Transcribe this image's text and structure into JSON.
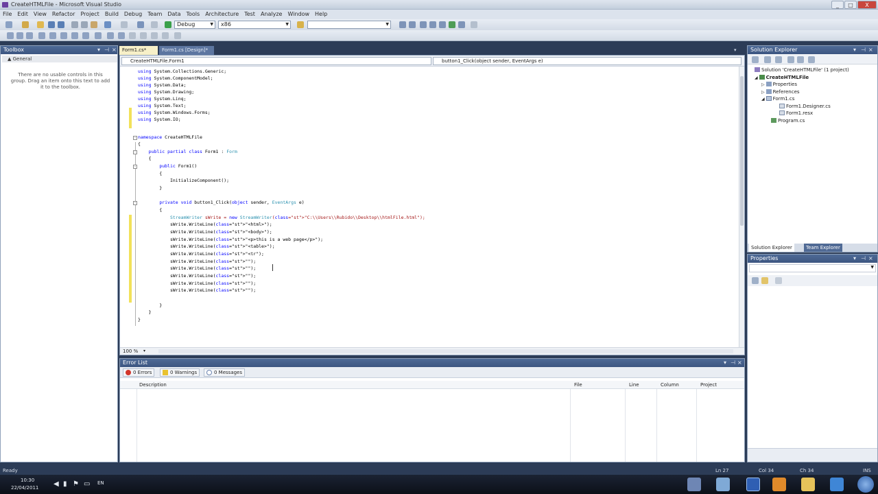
{
  "window": {
    "title": "CreateHTMLFile - Microsoft Visual Studio",
    "controls": [
      "_",
      "□",
      "X"
    ]
  },
  "menu": [
    "File",
    "Edit",
    "View",
    "Refactor",
    "Project",
    "Build",
    "Debug",
    "Team",
    "Data",
    "Tools",
    "Architecture",
    "Test",
    "Analyze",
    "Window",
    "Help"
  ],
  "toolbar": {
    "config": "Debug",
    "platform": "x86",
    "find": ""
  },
  "toolbox": {
    "title": "Toolbox",
    "group": "▲ General",
    "message": "There are no usable controls in this group. Drag an item onto this text to add it to the toolbox."
  },
  "tabs": [
    "Form1.cs*",
    "Form1.cs [Design]*"
  ],
  "nav": {
    "left": "CreateHTMLFile.Form1",
    "right": "button1_Click(object sender, EventArgs e)"
  },
  "code": [
    "using System.Collections.Generic;",
    "using System.ComponentModel;",
    "using System.Data;",
    "using System.Drawing;",
    "using System.Linq;",
    "using System.Text;",
    "using System.Windows.Forms;",
    "using System.IO;",
    "",
    "namespace CreateHTMLFile",
    "{",
    "    public partial class Form1 : Form",
    "    {",
    "        public Form1()",
    "        {",
    "            InitializeComponent();",
    "        }",
    "",
    "        private void button1_Click(object sender, EventArgs e)",
    "        {",
    "            StreamWriter sWrite = new StreamWriter(\"C:\\\\Users\\\\Rubido\\\\Desktop\\\\htmlFile.html\");",
    "            sWrite.WriteLine(\"<html>\");",
    "            sWrite.WriteLine(\"<body>\");",
    "            sWrite.WriteLine(\"<p>this is a web page</p>\");",
    "            sWrite.WriteLine(\"<table>\");",
    "            sWrite.WriteLine(\"<tr\");",
    "            sWrite.WriteLine(\"\");",
    "            sWrite.WriteLine(\"\");",
    "            sWrite.WriteLine(\"\");",
    "            sWrite.WriteLine(\"\");",
    "            sWrite.WriteLine(\"\");",
    "",
    "        }",
    "    }",
    "}"
  ],
  "zoom": "100 %",
  "errorlist": {
    "title": "Error List",
    "errors": "0 Errors",
    "warnings": "0 Warnings",
    "messages": "0 Messages",
    "columns": {
      "description": "Description",
      "file": "File",
      "line": "Line",
      "column": "Column",
      "project": "Project"
    }
  },
  "solution": {
    "title": "Solution Explorer",
    "items": [
      "Solution 'CreateHTMLFile' (1 project)",
      "CreateHTMLFile",
      "Properties",
      "References",
      "Form1.cs",
      "Form1.Designer.cs",
      "Form1.resx",
      "Program.cs"
    ],
    "tabs": [
      "Solution Explorer",
      "Team Explorer"
    ]
  },
  "properties": {
    "title": "Properties"
  },
  "status": {
    "ready": "Ready",
    "ln": "Ln 27",
    "col": "Col 34",
    "ch": "Ch 34",
    "ins": "INS"
  },
  "taskbar": {
    "time": "10:30",
    "date": "22/04/2011",
    "lang": "EN"
  },
  "colors": {
    "accent": "#3d5681",
    "keyword": "#0000ff",
    "type": "#2b91af",
    "string": "#a31515"
  }
}
